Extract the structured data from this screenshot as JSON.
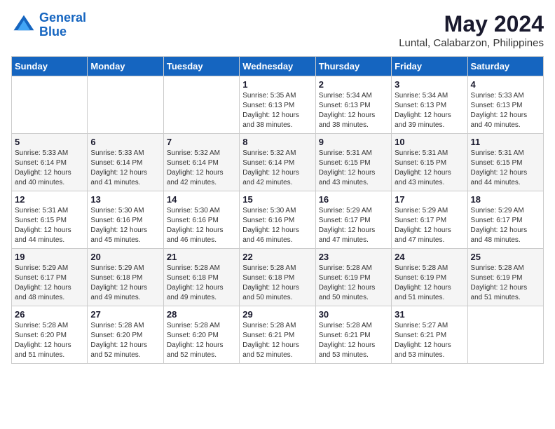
{
  "logo": {
    "line1": "General",
    "line2": "Blue"
  },
  "title": "May 2024",
  "subtitle": "Luntal, Calabarzon, Philippines",
  "days_of_week": [
    "Sunday",
    "Monday",
    "Tuesday",
    "Wednesday",
    "Thursday",
    "Friday",
    "Saturday"
  ],
  "weeks": [
    [
      {
        "day": "",
        "info": ""
      },
      {
        "day": "",
        "info": ""
      },
      {
        "day": "",
        "info": ""
      },
      {
        "day": "1",
        "info": "Sunrise: 5:35 AM\nSunset: 6:13 PM\nDaylight: 12 hours\nand 38 minutes."
      },
      {
        "day": "2",
        "info": "Sunrise: 5:34 AM\nSunset: 6:13 PM\nDaylight: 12 hours\nand 38 minutes."
      },
      {
        "day": "3",
        "info": "Sunrise: 5:34 AM\nSunset: 6:13 PM\nDaylight: 12 hours\nand 39 minutes."
      },
      {
        "day": "4",
        "info": "Sunrise: 5:33 AM\nSunset: 6:13 PM\nDaylight: 12 hours\nand 40 minutes."
      }
    ],
    [
      {
        "day": "5",
        "info": "Sunrise: 5:33 AM\nSunset: 6:14 PM\nDaylight: 12 hours\nand 40 minutes."
      },
      {
        "day": "6",
        "info": "Sunrise: 5:33 AM\nSunset: 6:14 PM\nDaylight: 12 hours\nand 41 minutes."
      },
      {
        "day": "7",
        "info": "Sunrise: 5:32 AM\nSunset: 6:14 PM\nDaylight: 12 hours\nand 42 minutes."
      },
      {
        "day": "8",
        "info": "Sunrise: 5:32 AM\nSunset: 6:14 PM\nDaylight: 12 hours\nand 42 minutes."
      },
      {
        "day": "9",
        "info": "Sunrise: 5:31 AM\nSunset: 6:15 PM\nDaylight: 12 hours\nand 43 minutes."
      },
      {
        "day": "10",
        "info": "Sunrise: 5:31 AM\nSunset: 6:15 PM\nDaylight: 12 hours\nand 43 minutes."
      },
      {
        "day": "11",
        "info": "Sunrise: 5:31 AM\nSunset: 6:15 PM\nDaylight: 12 hours\nand 44 minutes."
      }
    ],
    [
      {
        "day": "12",
        "info": "Sunrise: 5:31 AM\nSunset: 6:15 PM\nDaylight: 12 hours\nand 44 minutes."
      },
      {
        "day": "13",
        "info": "Sunrise: 5:30 AM\nSunset: 6:16 PM\nDaylight: 12 hours\nand 45 minutes."
      },
      {
        "day": "14",
        "info": "Sunrise: 5:30 AM\nSunset: 6:16 PM\nDaylight: 12 hours\nand 46 minutes."
      },
      {
        "day": "15",
        "info": "Sunrise: 5:30 AM\nSunset: 6:16 PM\nDaylight: 12 hours\nand 46 minutes."
      },
      {
        "day": "16",
        "info": "Sunrise: 5:29 AM\nSunset: 6:17 PM\nDaylight: 12 hours\nand 47 minutes."
      },
      {
        "day": "17",
        "info": "Sunrise: 5:29 AM\nSunset: 6:17 PM\nDaylight: 12 hours\nand 47 minutes."
      },
      {
        "day": "18",
        "info": "Sunrise: 5:29 AM\nSunset: 6:17 PM\nDaylight: 12 hours\nand 48 minutes."
      }
    ],
    [
      {
        "day": "19",
        "info": "Sunrise: 5:29 AM\nSunset: 6:17 PM\nDaylight: 12 hours\nand 48 minutes."
      },
      {
        "day": "20",
        "info": "Sunrise: 5:29 AM\nSunset: 6:18 PM\nDaylight: 12 hours\nand 49 minutes."
      },
      {
        "day": "21",
        "info": "Sunrise: 5:28 AM\nSunset: 6:18 PM\nDaylight: 12 hours\nand 49 minutes."
      },
      {
        "day": "22",
        "info": "Sunrise: 5:28 AM\nSunset: 6:18 PM\nDaylight: 12 hours\nand 50 minutes."
      },
      {
        "day": "23",
        "info": "Sunrise: 5:28 AM\nSunset: 6:19 PM\nDaylight: 12 hours\nand 50 minutes."
      },
      {
        "day": "24",
        "info": "Sunrise: 5:28 AM\nSunset: 6:19 PM\nDaylight: 12 hours\nand 51 minutes."
      },
      {
        "day": "25",
        "info": "Sunrise: 5:28 AM\nSunset: 6:19 PM\nDaylight: 12 hours\nand 51 minutes."
      }
    ],
    [
      {
        "day": "26",
        "info": "Sunrise: 5:28 AM\nSunset: 6:20 PM\nDaylight: 12 hours\nand 51 minutes."
      },
      {
        "day": "27",
        "info": "Sunrise: 5:28 AM\nSunset: 6:20 PM\nDaylight: 12 hours\nand 52 minutes."
      },
      {
        "day": "28",
        "info": "Sunrise: 5:28 AM\nSunset: 6:20 PM\nDaylight: 12 hours\nand 52 minutes."
      },
      {
        "day": "29",
        "info": "Sunrise: 5:28 AM\nSunset: 6:21 PM\nDaylight: 12 hours\nand 52 minutes."
      },
      {
        "day": "30",
        "info": "Sunrise: 5:28 AM\nSunset: 6:21 PM\nDaylight: 12 hours\nand 53 minutes."
      },
      {
        "day": "31",
        "info": "Sunrise: 5:27 AM\nSunset: 6:21 PM\nDaylight: 12 hours\nand 53 minutes."
      },
      {
        "day": "",
        "info": ""
      }
    ]
  ]
}
